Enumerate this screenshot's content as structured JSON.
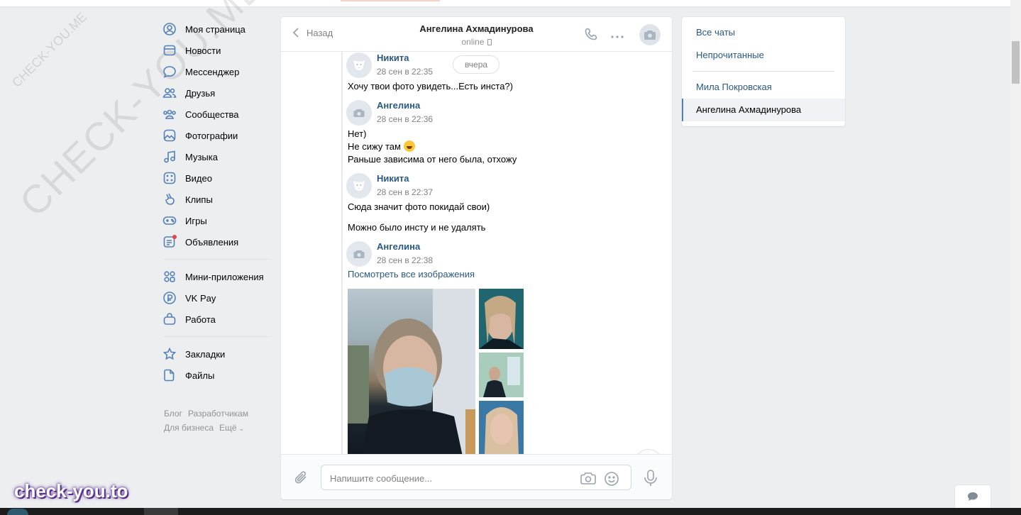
{
  "nav": {
    "items": [
      {
        "label": "Моя страница",
        "icon": "user-circle-icon"
      },
      {
        "label": "Новости",
        "icon": "newspaper-icon"
      },
      {
        "label": "Мессенджер",
        "icon": "message-icon"
      },
      {
        "label": "Друзья",
        "icon": "friends-icon"
      },
      {
        "label": "Сообщества",
        "icon": "communities-icon"
      },
      {
        "label": "Фотографии",
        "icon": "photo-icon"
      },
      {
        "label": "Музыка",
        "icon": "music-icon"
      },
      {
        "label": "Видео",
        "icon": "video-icon"
      },
      {
        "label": "Клипы",
        "icon": "clips-icon"
      },
      {
        "label": "Игры",
        "icon": "gamepad-icon"
      },
      {
        "label": "Объявления",
        "icon": "ads-icon"
      }
    ],
    "items2": [
      {
        "label": "Мини-приложения",
        "icon": "apps-icon"
      },
      {
        "label": "VK Pay",
        "icon": "vkpay-icon"
      },
      {
        "label": "Работа",
        "icon": "briefcase-icon"
      }
    ],
    "items3": [
      {
        "label": "Закладки",
        "icon": "star-icon"
      },
      {
        "label": "Файлы",
        "icon": "file-icon"
      }
    ],
    "footer": {
      "blog": "Блог",
      "developers": "Разработчикам",
      "business": "Для бизнеса",
      "more": "Ещё"
    }
  },
  "watermark": {
    "big": "CHECK-YOU.ME",
    "small": "CHECK-YOU.ME",
    "brand": "check-you.to"
  },
  "chat": {
    "back_label": "Назад",
    "peer_name": "Ангелина Ахмадинурова",
    "peer_status": "online",
    "day_divider": "вчера",
    "messages": [
      {
        "author": "Никита",
        "time": "28 сен в 22:35",
        "lines": [
          "Хочу твои фото увидеть...Есть инста?)"
        ]
      },
      {
        "author": "Ангелина",
        "time": "28 сен в 22:36",
        "lines": [
          "Нет)",
          "Не сижу там",
          "Раньше зависима от него была, отхожу"
        ]
      },
      {
        "author": "Никита",
        "time": "28 сен в 22:37",
        "lines": [
          "Сюда значит фото покидай свои)",
          "Можно было инсту и не удалять"
        ]
      },
      {
        "author": "Ангелина",
        "time": "28 сен в 22:38",
        "lines": []
      }
    ],
    "view_all_images": "Посмотреть все изображения",
    "composer_placeholder": "Напишите сообщение..."
  },
  "right_panel": {
    "all_chats": "Все чаты",
    "unread": "Непрочитанные",
    "conversations": [
      "Мила Покровская",
      "Ангелина Ахмадинурова"
    ]
  },
  "colors": {
    "accent": "#5181b8",
    "link": "#2a5885",
    "background": "#edeef0"
  }
}
